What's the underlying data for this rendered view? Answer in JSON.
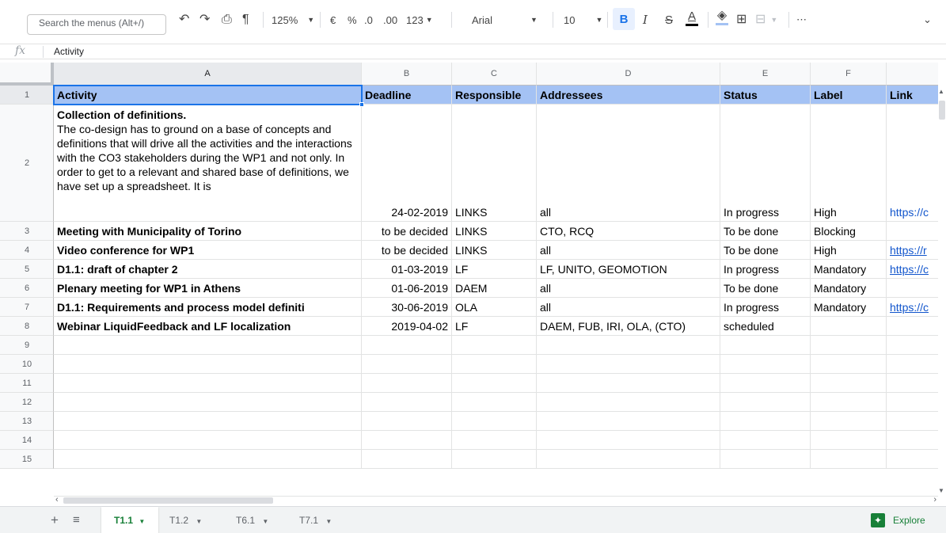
{
  "toolbar": {
    "search_placeholder": "Search the menus (Alt+/)",
    "undo_icon": "undo-icon",
    "redo_icon": "redo-icon",
    "print_icon": "print-icon",
    "paint_format_icon": "paint-format-icon",
    "zoom": "125%",
    "currency": "€",
    "percent": "%",
    "decrease_decimal": ".0",
    "increase_decimal": ".00",
    "more_formats": "123",
    "font": "Arial",
    "font_size": "10",
    "bold": "B",
    "italic": "I",
    "strikethrough": "S",
    "text_color": "A",
    "text_color_bar": "#000000",
    "fill_color_bar": "#a4c2f4",
    "more": "⋯"
  },
  "formula_bar": {
    "fx": "fx",
    "content": "Activity"
  },
  "columns": [
    "A",
    "B",
    "C",
    "D",
    "E",
    "F",
    ""
  ],
  "header_row": {
    "activity": "Activity",
    "deadline": "Deadline",
    "responsible": "Responsible",
    "addressees": "Addressees",
    "status": "Status",
    "label": "Label",
    "link": "Link"
  },
  "row2": {
    "title": "Collection of definitions.",
    "text": "The co-design has to ground on a base of concepts and definitions that will drive all the activities and the interactions with the CO3 stakeholders during the WP1 and not only. In order to get to a relevant and shared base of definitions, we have set up a spreadsheet. It is",
    "deadline": "24-02-2019",
    "responsible": "LINKS",
    "addressees": "all",
    "status": "In progress",
    "label": "High",
    "link": "https://c"
  },
  "rows": [
    {
      "num": "3",
      "activity": "Meeting with Municipality of Torino",
      "deadline": "to be decided",
      "responsible": "LINKS",
      "addressees": "CTO, RCQ",
      "status": "To be done",
      "label": "Blocking",
      "link": ""
    },
    {
      "num": "4",
      "activity": "Video conference for WP1",
      "deadline": "to be decided",
      "responsible": "LINKS",
      "addressees": "all",
      "status": "To be done",
      "label": "High",
      "link": "https://r"
    },
    {
      "num": "5",
      "activity": "D1.1: draft of chapter 2",
      "deadline": "01-03-2019",
      "responsible": "LF",
      "addressees": "LF, UNITO, GEOMOTION",
      "status": "In progress",
      "label": "Mandatory",
      "link": "https://c"
    },
    {
      "num": "6",
      "activity": "Plenary meeting for WP1 in Athens",
      "deadline": "01-06-2019",
      "responsible": "DAEM",
      "addressees": "all",
      "status": "To be done",
      "label": "Mandatory",
      "link": ""
    },
    {
      "num": "7",
      "activity": "D1.1: Requirements and process model definiti",
      "deadline": "30-06-2019",
      "responsible": "OLA",
      "addressees": "all",
      "status": "In progress",
      "label": "Mandatory",
      "link": "https://c"
    },
    {
      "num": "8",
      "activity": "Webinar LiquidFeedback and LF localization",
      "deadline": "2019-04-02",
      "responsible": "LF",
      "addressees": "DAEM, FUB, IRI, OLA, (CTO)",
      "status": "scheduled",
      "label": "",
      "link": ""
    }
  ],
  "row_numbers": [
    "1",
    "2",
    "9",
    "10",
    "11",
    "12",
    "13",
    "14",
    "15"
  ],
  "tabs": [
    {
      "label": "T1.1"
    },
    {
      "label": "T1.2"
    },
    {
      "label": "T6.1"
    },
    {
      "label": "T7.1"
    }
  ],
  "explore_label": "Explore"
}
